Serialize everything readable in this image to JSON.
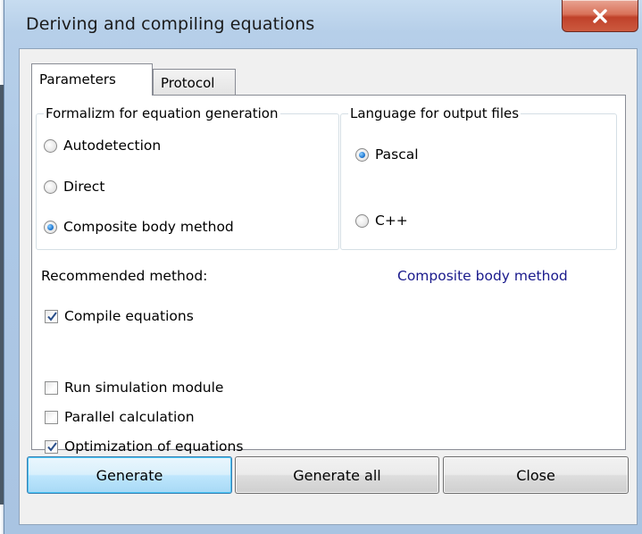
{
  "window": {
    "title": "Deriving and compiling equations",
    "close_icon": "close-icon",
    "accent_color": "#c7402a"
  },
  "tabs": [
    {
      "label": "Parameters",
      "selected": true
    },
    {
      "label": "Protocol",
      "selected": false
    }
  ],
  "formalism_group": {
    "legend": "Formalizm for equation generation",
    "options": [
      {
        "label": "Autodetection",
        "selected": false
      },
      {
        "label": "Direct",
        "selected": false
      },
      {
        "label": "Composite body method",
        "selected": true
      }
    ]
  },
  "language_group": {
    "legend": "Language for output files",
    "options": [
      {
        "label": "Pascal",
        "selected": true
      },
      {
        "label": "C++",
        "selected": false
      }
    ]
  },
  "recommended": {
    "label": "Recommended method:",
    "value": "Composite body method",
    "value_color": "#1a1a8c"
  },
  "checkboxes": [
    {
      "label": "Compile equations",
      "checked": true
    },
    {
      "label": "Run simulation module",
      "checked": false
    },
    {
      "label": "Parallel calculation",
      "checked": false
    },
    {
      "label": "Optimization of equations",
      "checked": true
    }
  ],
  "buttons": {
    "generate": "Generate",
    "generate_all": "Generate all",
    "close": "Close"
  }
}
